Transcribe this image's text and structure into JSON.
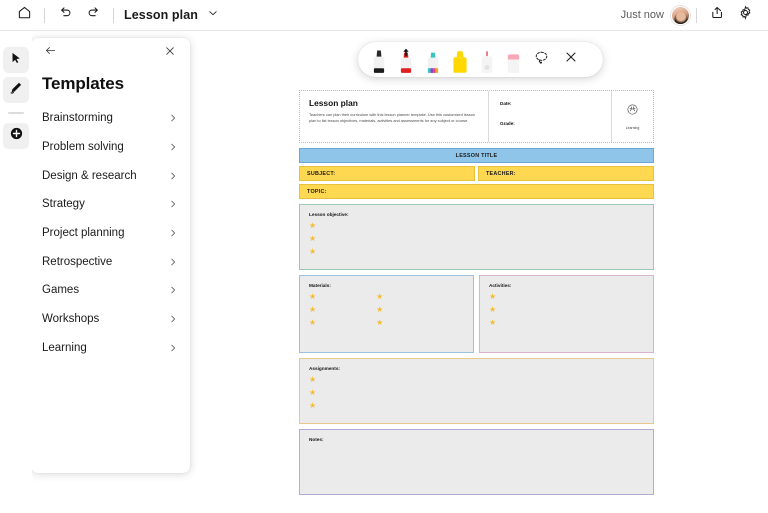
{
  "topbar": {
    "home_icon": "home-icon",
    "undo_icon": "undo-icon",
    "redo_icon": "redo-icon",
    "doc_title": "Lesson plan",
    "chevron_icon": "chevron-down-icon",
    "saved_status": "Just now",
    "avatar_name": "user-avatar",
    "share_icon": "share-icon",
    "settings_icon": "gear-icon"
  },
  "rail": {
    "items": [
      {
        "name": "select-tool",
        "icon": "cursor-arrow-icon"
      },
      {
        "name": "pen-tool",
        "icon": "pen-icon"
      },
      {
        "name": "add-tool",
        "icon": "plus-circle-icon"
      }
    ]
  },
  "panel": {
    "back_icon": "back-arrow-icon",
    "close_icon": "close-icon",
    "title": "Templates",
    "items": [
      {
        "label": "Brainstorming"
      },
      {
        "label": "Problem solving"
      },
      {
        "label": "Design & research"
      },
      {
        "label": "Strategy"
      },
      {
        "label": "Project planning"
      },
      {
        "label": "Retrospective"
      },
      {
        "label": "Games"
      },
      {
        "label": "Workshops"
      },
      {
        "label": "Learning"
      }
    ],
    "chevron_icon": "chevron-right-icon"
  },
  "pen_toolbar": {
    "tools": [
      {
        "name": "pen-black",
        "color": "#1c1c1c",
        "selected": false
      },
      {
        "name": "pen-red",
        "color": "#e02020",
        "selected": true
      },
      {
        "name": "pen-rainbow",
        "color": "#39c4c4",
        "selected": false
      },
      {
        "name": "highlighter-yellow",
        "color": "#ffd800",
        "selected": false
      },
      {
        "name": "eraser-small",
        "color": "#e85b6a",
        "selected": false
      },
      {
        "name": "eraser-large",
        "color": "#f6a8b8",
        "selected": false
      }
    ],
    "lasso_icon": "lasso-select-icon",
    "close_icon": "close-icon"
  },
  "document": {
    "header": {
      "title": "Lesson plan",
      "description": "Teachers can plan their curriculum with this lesson planner template. Use this customized lesson plan to list lesson objectives, materials, activities and assessments for any subject or course.",
      "date_label": "Date:",
      "grade_label": "Grade:",
      "badge_icon": "learning-badge-icon",
      "badge_label": "Learning"
    },
    "lesson_title_bar": "LESSON TITLE",
    "subject_label": "SUBJECT:",
    "teacher_label": "TEACHER:",
    "topic_label": "TOPIC:",
    "sections": {
      "objective": {
        "label": "Lesson objective:",
        "stars": 3,
        "border": "#9cc9b4"
      },
      "materials": {
        "label": "Materials:",
        "stars_col1": 3,
        "stars_col2": 3,
        "border": "#9bc3e0"
      },
      "activities": {
        "label": "Activities:",
        "stars": 3,
        "border": "#d9b2cf"
      },
      "assignments": {
        "label": "Assignments:",
        "stars": 3,
        "border": "#e8c98b"
      },
      "notes": {
        "label": "Notes:",
        "stars": 0,
        "border": "#b4aad6"
      }
    },
    "star_glyph": "★",
    "colors": {
      "title_bar": "#8ec5e9",
      "label_bar": "#ffd851",
      "section_fill": "#ebebeb"
    }
  }
}
